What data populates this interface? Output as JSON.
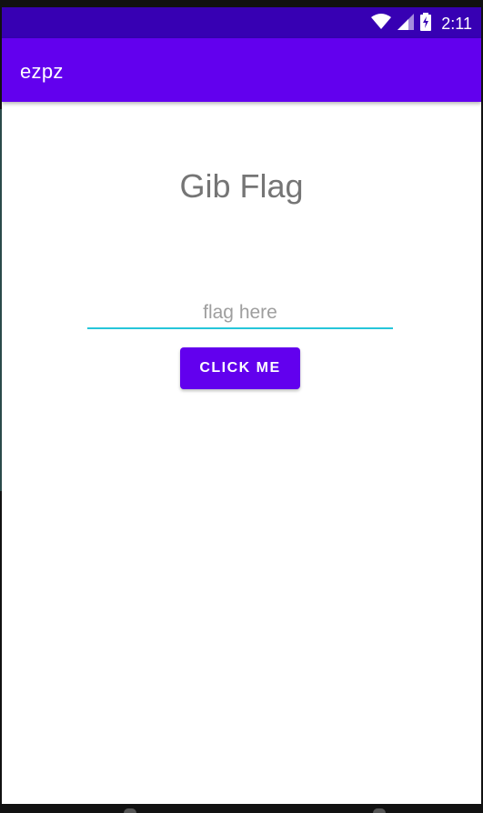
{
  "status_bar": {
    "time": "2:11",
    "icons": [
      "wifi-icon",
      "cell-signal-icon",
      "battery-charging-icon"
    ],
    "background": "#3700b3"
  },
  "app_bar": {
    "title": "ezpz",
    "background": "#6200ee"
  },
  "main": {
    "heading": "Gib Flag",
    "flag_input": {
      "value": "",
      "placeholder": "flag here"
    },
    "click_button_label": "CLICK ME"
  },
  "colors": {
    "accent": "#6200ee",
    "input_underline": "#26c6da",
    "heading_text": "#757575"
  }
}
